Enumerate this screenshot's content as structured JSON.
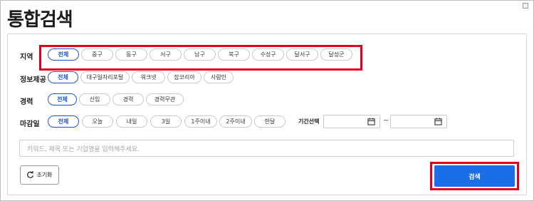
{
  "page": {
    "title": "통합검색"
  },
  "filters": {
    "region": {
      "label": "지역",
      "options": [
        "전체",
        "중구",
        "동구",
        "서구",
        "남구",
        "북구",
        "수성구",
        "달서구",
        "달성군"
      ],
      "selected": "전체"
    },
    "info": {
      "label": "정보제공",
      "options": [
        "전체",
        "대구일자리포털",
        "워크넷",
        "잡코리아",
        "사람인"
      ],
      "selected": "전체"
    },
    "career": {
      "label": "경력",
      "options": [
        "전체",
        "신입",
        "경력",
        "경력무관"
      ],
      "selected": "전체"
    },
    "deadline": {
      "label": "마감일",
      "options": [
        "전체",
        "오늘",
        "내일",
        "3일",
        "1주이내",
        "2주이내",
        "한달"
      ],
      "selected": "전체",
      "period_label": "기간선택",
      "range_separator": "~"
    }
  },
  "search": {
    "placeholder": "키워드, 제목 또는 기업명을 입력해주세요.",
    "value": ""
  },
  "buttons": {
    "reset": "초기화",
    "search": "검색"
  },
  "colors": {
    "accent": "#1a56db",
    "search_button": "#1a6fe8",
    "highlight": "#e0001c"
  },
  "icons": {
    "reset": "refresh-icon",
    "calendar": "calendar-icon"
  }
}
